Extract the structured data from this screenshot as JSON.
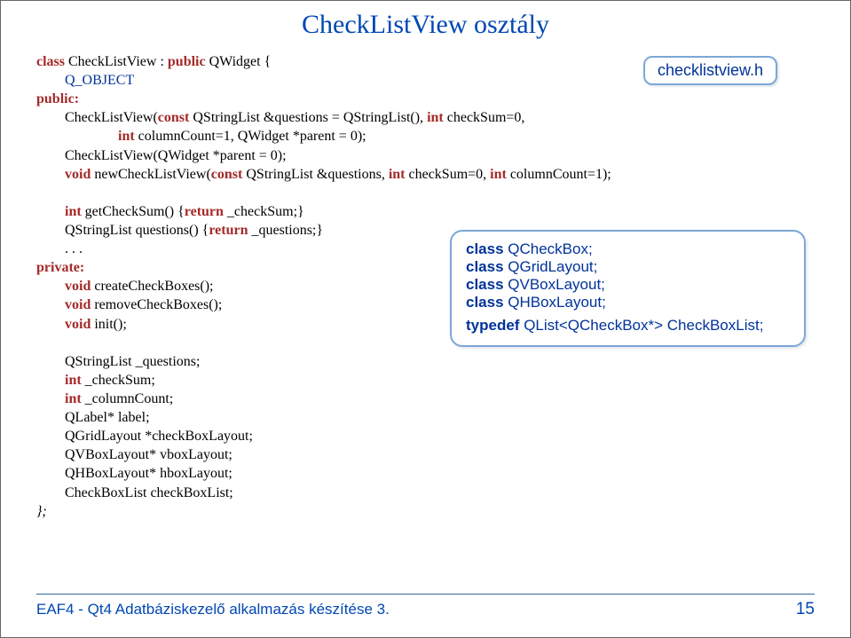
{
  "title": "CheckListView  osztály",
  "filename": "checklistview.h",
  "code": {
    "l1a": "class ",
    "l1b": "CheckListView : ",
    "l1c": "public",
    "l1d": " QWidget {",
    "l2": "        Q_OBJECT",
    "l3": "public:",
    "l4a": "        CheckListView(",
    "l4b": "const ",
    "l4c": "QStringList &questions = QStringList(),",
    "l4d": " int ",
    "l4e": "checkSum=0,",
    "l5a": "                       ",
    "l5b": "int ",
    "l5c": "columnCount=1, QWidget *parent = 0);",
    "l6": "        CheckListView(QWidget *parent = 0);",
    "l7a": "        ",
    "l7b": "void ",
    "l7c": "newCheckListView(",
    "l7d": "const ",
    "l7e": "QStringList &questions, ",
    "l7f": "int ",
    "l7g": "checkSum=0, ",
    "l7h": "int ",
    "l7i": "columnCount=1);",
    "l8": "",
    "l9a": "        ",
    "l9b": "int ",
    "l9c": "getCheckSum() {",
    "l9d": "return ",
    "l9e": "_checkSum;}",
    "l10a": "        QStringList questions() {",
    "l10b": "return ",
    "l10c": "_questions;}",
    "l11": "        . . .",
    "l12": "private:",
    "l13a": "        ",
    "l13b": "void ",
    "l13c": "createCheckBoxes();",
    "l14a": "        ",
    "l14b": "void ",
    "l14c": "removeCheckBoxes();",
    "l15a": "        ",
    "l15b": "void ",
    "l15c": "init();",
    "l16": "",
    "l17": "        QStringList _questions;",
    "l18a": "        ",
    "l18b": "int ",
    "l18c": "_checkSum;",
    "l19a": "        ",
    "l19b": "int ",
    "l19c": "_columnCount;",
    "l20": "        QLabel* label;",
    "l21": "        QGridLayout *checkBoxLayout;",
    "l22": "        QVBoxLayout* vboxLayout;",
    "l23": "        QHBoxLayout* hboxLayout;",
    "l24": "        CheckBoxList checkBoxList;",
    "l25": "};"
  },
  "classbox": {
    "l1a": "class ",
    "l1b": "QCheckBox;",
    "l2a": "class ",
    "l2b": "QGridLayout;",
    "l3a": "class ",
    "l3b": "QVBoxLayout;",
    "l4a": "class ",
    "l4b": "QHBoxLayout;",
    "l5a": "typedef ",
    "l5b": "QList<QCheckBox*> CheckBoxList;"
  },
  "footer_left": "EAF4 - Qt4 Adatbáziskezelő alkalmazás készítése 3.",
  "footer_right": "15"
}
